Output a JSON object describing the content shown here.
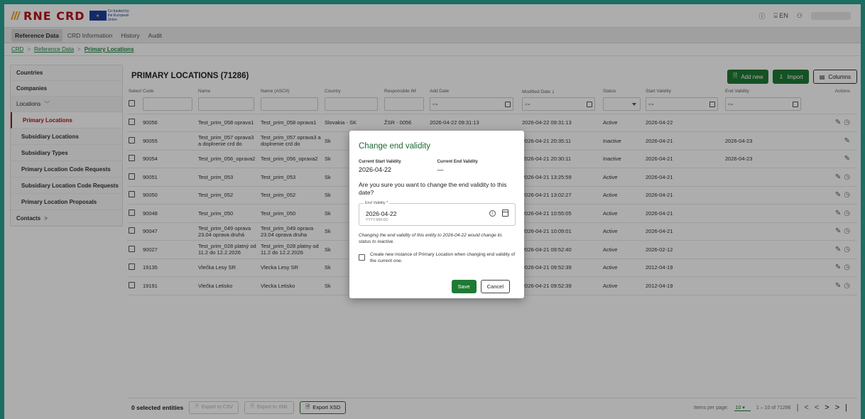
{
  "app": {
    "logo_text": "RNE CRD",
    "eu_line1": "Co-funded by",
    "eu_line2": "the European Union",
    "lang": "EN"
  },
  "nav": {
    "items": [
      "Reference Data",
      "CRD Information",
      "History",
      "Audit"
    ]
  },
  "breadcrumb": [
    "CRD",
    "Reference Data",
    "Primary Locations"
  ],
  "sidebar": {
    "countries": "Countries",
    "companies": "Companies",
    "locations": "Locations",
    "sub_items": [
      "Primary Locations",
      "Subsidiary Locations",
      "Subsidiary Types",
      "Primary Location Code Requests",
      "Subsidiary Location Code Requests",
      "Primary Location Proposals"
    ],
    "contacts": "Contacts"
  },
  "page": {
    "title": "PRIMARY LOCATIONS (71286)",
    "add_new": "Add new",
    "import": "Import",
    "columns": "Columns"
  },
  "table": {
    "headers": [
      "Select",
      "Code",
      "Name",
      "Name (ASCII)",
      "Country",
      "Responsible IM",
      "Add Date",
      "Modified Date",
      "Status",
      "Start Validity",
      "End Validity",
      "Actions"
    ],
    "sort_indicator": "↓",
    "filter_placeholder": "<=",
    "rows": [
      {
        "code": "90056",
        "name": "Test_prim_058 oprava1",
        "ascii": "Test_prim_058 oprava1",
        "country": "Slovakia - SK",
        "im": "ŽSR - 0056",
        "add": "2026-04-22 09:31:13",
        "mod": "2026-04-22 09:31:13",
        "status": "Active",
        "start": "2026-04-22",
        "end": ""
      },
      {
        "code": "90055",
        "name": "Test_prim_057 oprava3 a doplnenie crd do",
        "ascii": "Test_prim_057 oprava3 a doplnenie crd do",
        "country": "Sk",
        "im": "",
        "add": "",
        "mod": "2026-04-21 20:35:11",
        "status": "Inactive",
        "start": "2026-04-21",
        "end": "2026-04-23"
      },
      {
        "code": "90054",
        "name": "Test_prim_056_oprava2",
        "ascii": "Test_prim_056_oprava2",
        "country": "Sk",
        "im": "",
        "add": "",
        "mod": "2026-04-21 20:30:11",
        "status": "Inactive",
        "start": "2026-04-21",
        "end": "2026-04-23"
      },
      {
        "code": "90051",
        "name": "Test_prim_053",
        "ascii": "Test_prim_053",
        "country": "Sk",
        "im": "",
        "add": "",
        "mod": "2026-04-21 13:25:59",
        "status": "Active",
        "start": "2026-04-21",
        "end": ""
      },
      {
        "code": "90050",
        "name": "Test_prim_052",
        "ascii": "Test_prim_052",
        "country": "Sk",
        "im": "",
        "add": "",
        "mod": "2026-04-21 13:02:27",
        "status": "Active",
        "start": "2026-04-21",
        "end": ""
      },
      {
        "code": "90048",
        "name": "Test_prim_050",
        "ascii": "Test_prim_050",
        "country": "Sk",
        "im": "",
        "add": "",
        "mod": "2026-04-21 10:55:05",
        "status": "Active",
        "start": "2026-04-21",
        "end": ""
      },
      {
        "code": "90047",
        "name": "Test_prim_049 oprava 23.04 oprava druhá",
        "ascii": "Test_prim_049 oprava 23.04 oprava druha",
        "country": "Sk",
        "im": "",
        "add": "",
        "mod": "2026-04-21 10:09:01",
        "status": "Active",
        "start": "2026-04-21",
        "end": ""
      },
      {
        "code": "90027",
        "name": "Test_prim_028 platný od 11.2 do 12.2.2026",
        "ascii": "Test_prim_028 platny od 11.2 do 12.2.2026",
        "country": "Sk",
        "im": "",
        "add": "",
        "mod": "2026-04-21 09:52:40",
        "status": "Active",
        "start": "2026-02-12",
        "end": ""
      },
      {
        "code": "19135",
        "name": "Vlečka Lesy SR",
        "ascii": "Vlecka Lesy SR",
        "country": "Sk",
        "im": "",
        "add": "",
        "mod": "2026-04-21 09:52:39",
        "status": "Active",
        "start": "2012-04-19",
        "end": ""
      },
      {
        "code": "19191",
        "name": "Vlečka Letisko",
        "ascii": "Vlecka Letisko",
        "country": "Sk",
        "im": "",
        "add": "",
        "mod": "2026-04-21 09:52:39",
        "status": "Active",
        "start": "2012-04-19",
        "end": ""
      }
    ]
  },
  "footer": {
    "selected": "0 selected entities",
    "export_csv": "Export to CSV",
    "export_xml": "Export to XML",
    "export_xsd": "Export XSD",
    "items_per_page_label": "Items per page:",
    "items_per_page": "10",
    "range": "1 – 10 of 71286"
  },
  "dialog": {
    "title": "Change end validity",
    "start_label": "Current Start Validity",
    "start_value": "2026-04-22",
    "end_label": "Current End Validity",
    "end_value": "—",
    "question": "Are you sure you want to change the end validity to this date?",
    "field_label": "End Validity *",
    "field_value": "2026-04-22",
    "field_hint": "YYYY-MM-DD",
    "warning": "Changing the end validity of this entity to 2026-04-22 would change its status to inactive.",
    "checkbox_text": "Create new instance of Primary Location when changing end validity of the current one.",
    "save": "Save",
    "cancel": "Cancel"
  }
}
